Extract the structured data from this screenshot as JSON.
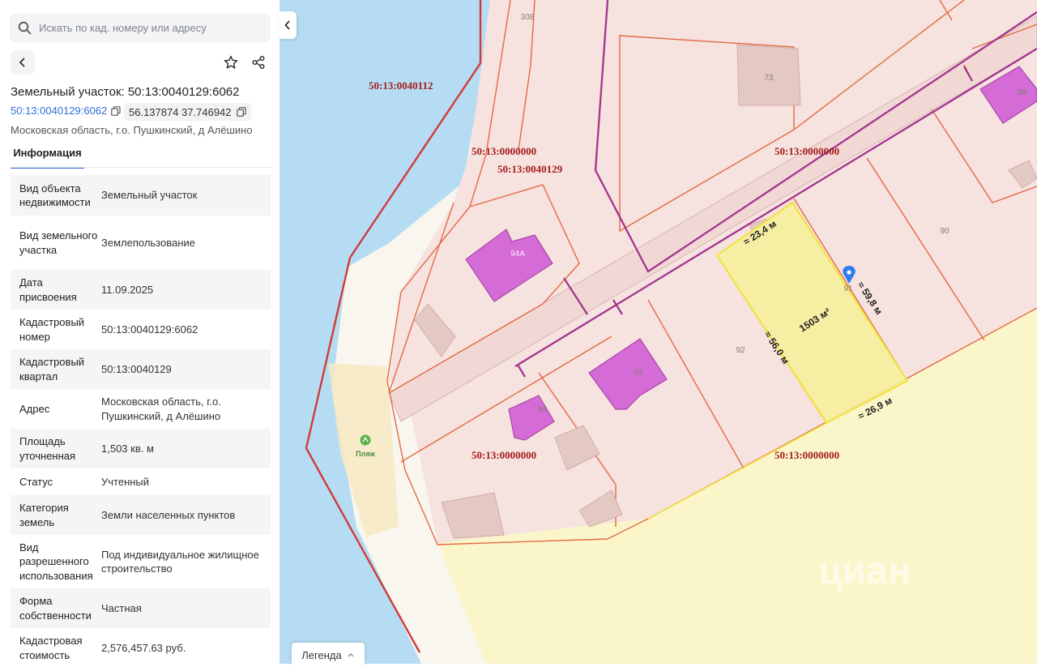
{
  "search": {
    "placeholder": "Искать по кад. номеру или адресу"
  },
  "header": {
    "title": "Земельный участок: 50:13:0040129:6062",
    "cad_number": "50:13:0040129:6062",
    "coordinates": "56.137874 37.746942",
    "address_line": "Московская область, г.о. Пушкинский, д Алёшино"
  },
  "tabs": [
    {
      "label": "Информация"
    }
  ],
  "info": [
    {
      "key": "Вид объекта недвижимости",
      "value": "Земельный участок"
    },
    {
      "key": "Вид земельного участка",
      "value": "Землепользование"
    },
    {
      "key": "Дата присвоения",
      "value": "11.09.2025"
    },
    {
      "key": "Кадастровый номер",
      "value": "50:13:0040129:6062"
    },
    {
      "key": "Кадастровый квартал",
      "value": "50:13:0040129"
    },
    {
      "key": "Адрес",
      "value": "Московская область, г.о. Пушкинский, д Алёшино"
    },
    {
      "key": "Площадь уточненная",
      "value": "1,503 кв. м"
    },
    {
      "key": "Статус",
      "value": "Учтенный"
    },
    {
      "key": "Категория земель",
      "value": "Земли населенных пунктов"
    },
    {
      "key": "Вид разрешенного использования",
      "value": "Под индивидуальное жилищное строительство"
    },
    {
      "key": "Форма собственности",
      "value": "Частная"
    },
    {
      "key": "Кадастровая стоимость",
      "value": "2,576,457.63 руб."
    }
  ],
  "map": {
    "quarter_labels": [
      "50:13:0040112",
      "50:13:0000000",
      "50:13:0040129",
      "50:13:0000000",
      "50:13:0000000",
      "50:13:0000000"
    ],
    "parcel_numbers": [
      "308",
      "73",
      "89",
      "90",
      "94А",
      "91",
      "92",
      "93",
      "94"
    ],
    "dimensions": {
      "top": "≈ 23,4 м",
      "right": "≈ 59,8 м",
      "left": "≈ 56,0 м",
      "bottom": "≈ 26,9 м"
    },
    "area_label": "1503 м²",
    "poi_label": "Пляж",
    "watermark": "циан",
    "colors": {
      "water": "#b5dcf3",
      "parcel": "#f6e2de",
      "selected": "#f5ef9c",
      "building": "#d46bd6",
      "boundary": "#e46a45",
      "quarter_line": "#d23a3a",
      "road_line": "#a23590"
    }
  },
  "legend": {
    "label": "Легенда"
  }
}
